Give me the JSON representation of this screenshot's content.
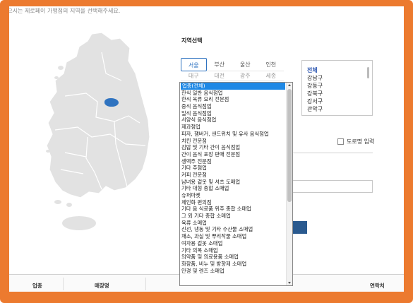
{
  "page": {
    "instruction": "찾으시는 제로페이 가맹점의 지역을 선택해주세요."
  },
  "colors": {
    "frame": "#ec7a2f",
    "accent": "#2f73c0",
    "selected_bg": "#1e88e5",
    "button_dark": "#2a5a8f",
    "map_fill": "#e2e2e2"
  },
  "region": {
    "title": "지역선택",
    "row1": [
      "서울",
      "부산",
      "울산",
      "인천"
    ],
    "row2": [
      "대구",
      "대전",
      "광주",
      "세종"
    ],
    "selected": "서울"
  },
  "district": {
    "items": [
      "전체",
      "강남구",
      "강동구",
      "강북구",
      "강서구",
      "관악구"
    ]
  },
  "road_option": {
    "label": "도로명 입력",
    "checked": false
  },
  "category_dropdown": {
    "selected_index": 0,
    "hovered_index": 29,
    "options": [
      "업종(전체)",
      "한식 일반 음식점업",
      "한식 육류 요리 전문점",
      "중식 음식점업",
      "일식 음식점업",
      "서양식 음식점업",
      "제과점업",
      "피자, 햄버거, 샌드위치 및 유사 음식점업",
      "치킨 전문점",
      "김밥 및 기타 간이 음식점업",
      "간이 음식 포장 판매 전문점",
      "생맥주 전문점",
      "기타 주점업",
      "커피 전문점",
      "남녀용 겉옷 및 셔츠 도매업",
      "기타 대형 종합 소매업",
      "슈퍼마켓",
      "체인화 편의점",
      "기타 음 식료품 위주 종합 소매업",
      "그 외 기타 종합 소매업",
      "육류 소매업",
      "신선, 냉동 및 기타 수산물 소매업",
      "채소, 과실 및 뿌리작물 소매업",
      "여자용 겉옷 소매업",
      "기타 의복 소매업",
      "의약품 및 의료용품 소매업",
      "화장품, 비누 및 방향제 소매업",
      "안경 및 렌즈 소매업"
    ]
  },
  "table": {
    "headers": [
      "업종",
      "매장명",
      "연락처"
    ]
  },
  "icons": {
    "map": "south-korea-map",
    "checkbox": "checkbox-icon",
    "scroll_up": "triangle-up-icon",
    "scroll_down": "triangle-down-icon"
  }
}
